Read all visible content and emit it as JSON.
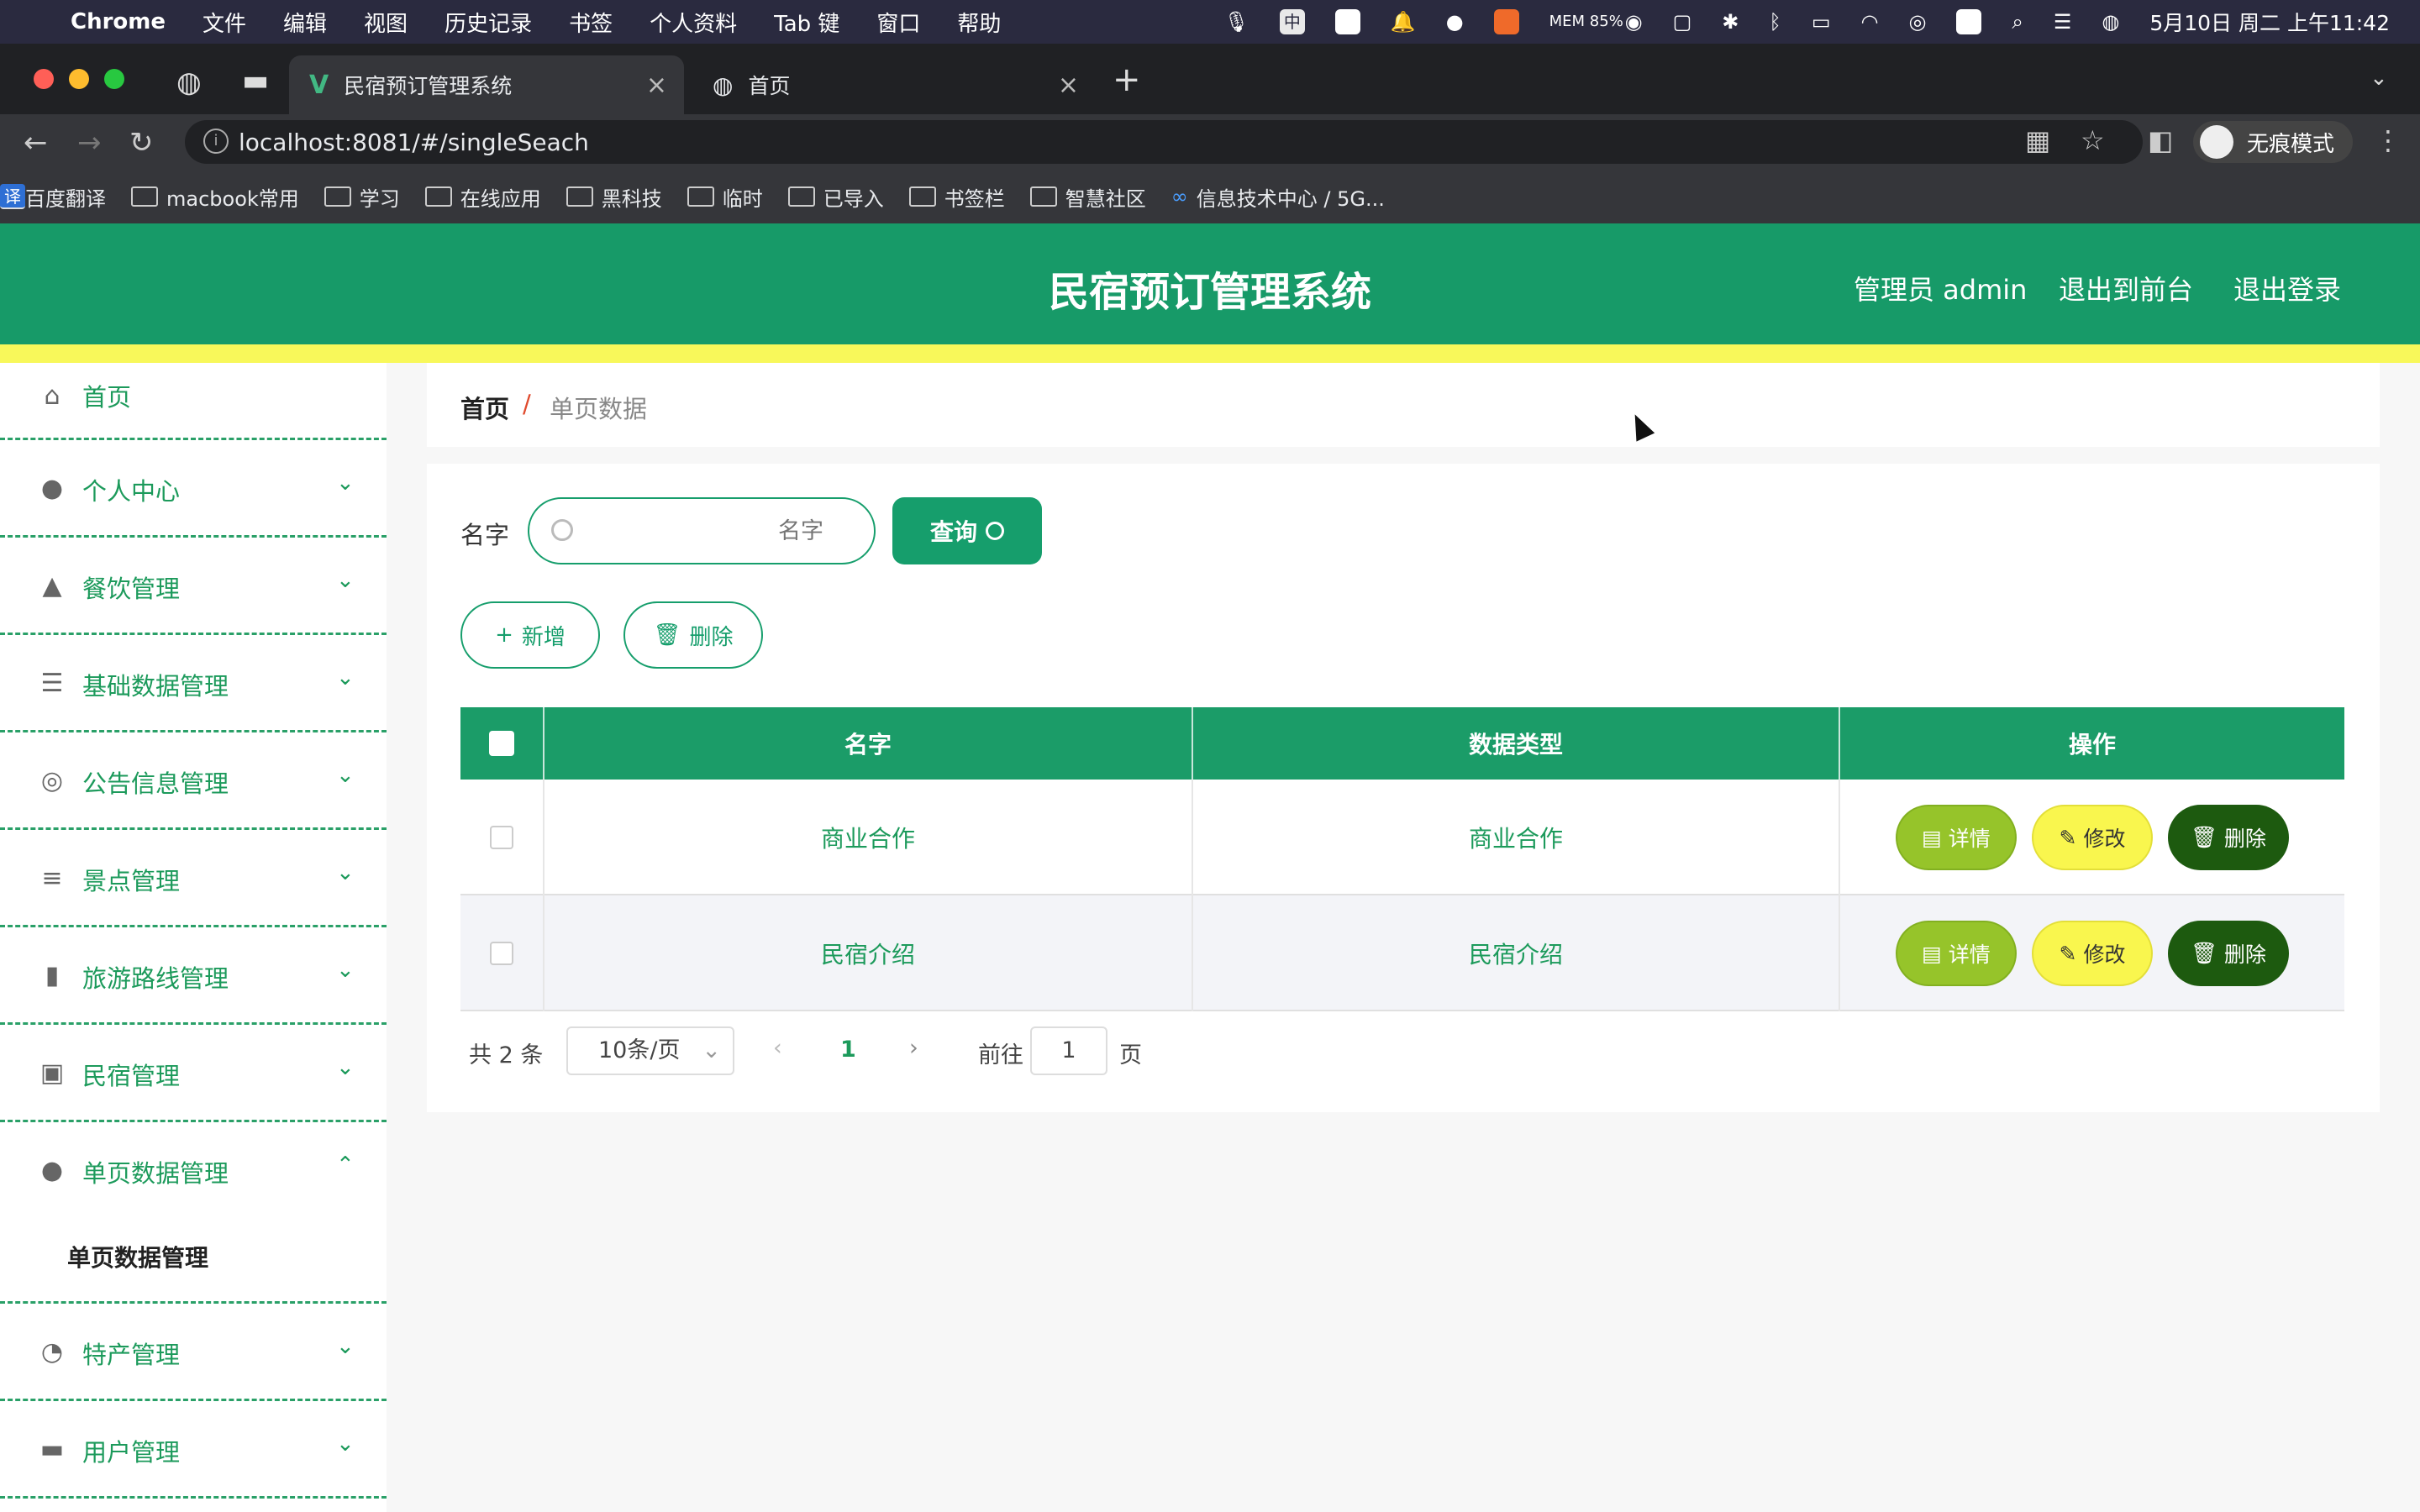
{
  "menubar": {
    "app": "Chrome",
    "items": [
      "文件",
      "编辑",
      "视图",
      "历史记录",
      "书签",
      "个人资料",
      "Tab 键",
      "窗口",
      "帮助"
    ],
    "mem": "MEM 85%",
    "ime": "中",
    "datetime": "5月10日 周二 上午11:42"
  },
  "tabs": {
    "active_title": "民宿预订管理系统",
    "second_title": "首页",
    "new_tab": "+"
  },
  "address": {
    "url": "localhost:8081/#/singleSeach",
    "incognito_label": "无痕模式"
  },
  "bookmarks": [
    "百度翻译",
    "macbook常用",
    "学习",
    "在线应用",
    "黑科技",
    "临时",
    "已导入",
    "书签栏",
    "智慧社区",
    "信息技术中心 / 5G..."
  ],
  "header": {
    "title": "民宿预订管理系统",
    "admin": "管理员 admin",
    "to_front": "退出到前台",
    "logout": "退出登录"
  },
  "sidebar": {
    "items": [
      {
        "label": "首页",
        "icon": "home-icon"
      },
      {
        "label": "个人中心",
        "icon": "user-icon"
      },
      {
        "label": "餐饮管理",
        "icon": "stamp-icon"
      },
      {
        "label": "基础数据管理",
        "icon": "list-icon"
      },
      {
        "label": "公告信息管理",
        "icon": "compass-icon"
      },
      {
        "label": "景点管理",
        "icon": "sliders-icon"
      },
      {
        "label": "旅游路线管理",
        "icon": "bar-chart-icon"
      },
      {
        "label": "民宿管理",
        "icon": "clipboard-icon"
      },
      {
        "label": "单页数据管理",
        "icon": "bulb-icon"
      },
      {
        "label": "特产管理",
        "icon": "stopwatch-icon"
      },
      {
        "label": "用户管理",
        "icon": "monitor-icon"
      }
    ],
    "sub_active": "单页数据管理"
  },
  "breadcrumb": {
    "home": "首页",
    "sep": "/",
    "current": "单页数据"
  },
  "search": {
    "label": "名字",
    "placeholder": "名字",
    "button": "查询"
  },
  "actions": {
    "add": "新增",
    "delete": "删除"
  },
  "table": {
    "headers": [
      "名字",
      "数据类型",
      "操作"
    ],
    "rows": [
      {
        "name": "商业合作",
        "type": "商业合作"
      },
      {
        "name": "民宿介绍",
        "type": "民宿介绍"
      }
    ],
    "btn_detail": "详情",
    "btn_edit": "修改",
    "btn_delete": "删除"
  },
  "pagination": {
    "total": "共 2 条",
    "page_size": "10条/页",
    "current_page": "1",
    "goto_label": "前往",
    "goto_value": "1",
    "page_suffix": "页"
  },
  "colors": {
    "primary": "#179a68",
    "accent_strip": "#f8f85a",
    "detail": "#96c42a",
    "edit": "#f9f64e",
    "delete": "#1d5a0f"
  }
}
